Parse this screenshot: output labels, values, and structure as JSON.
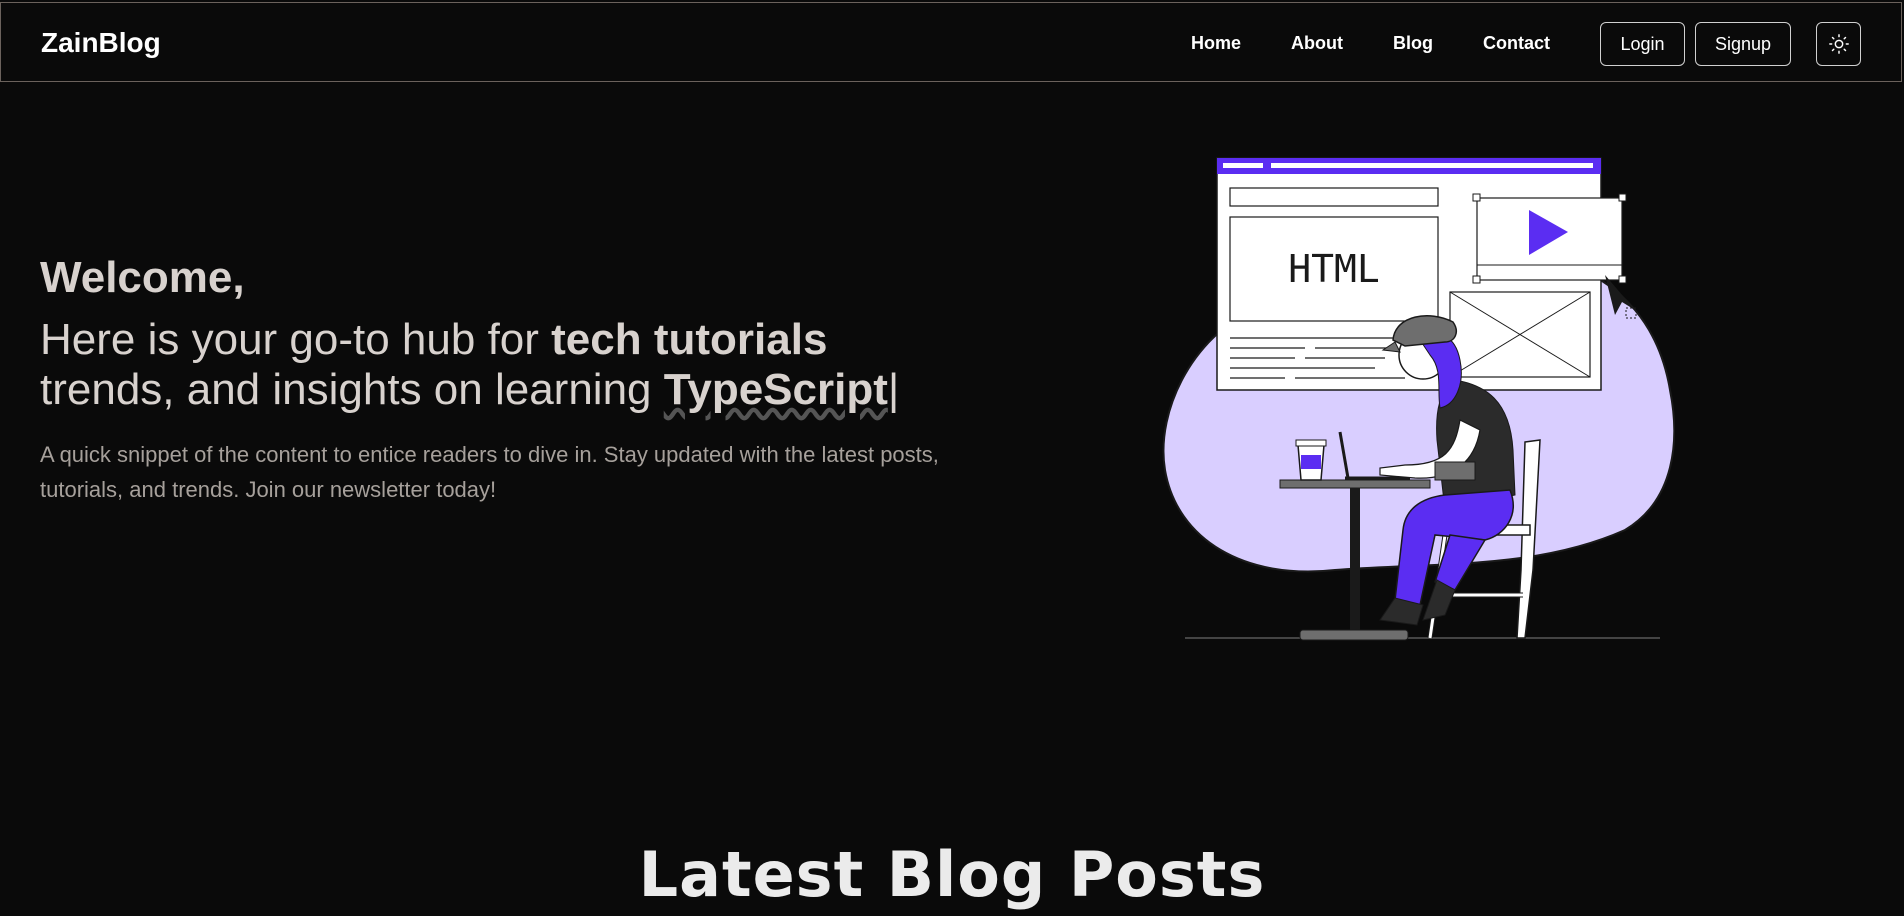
{
  "brand": {
    "name": "ZainBlog"
  },
  "nav": {
    "links": [
      "Home",
      "About",
      "Blog",
      "Contact"
    ],
    "login_label": "Login",
    "signup_label": "Signup",
    "theme_toggle_icon": "sun-icon"
  },
  "hero": {
    "welcome": "Welcome,",
    "tagline_part1": "Here is your go-to hub for ",
    "tagline_bold": "tech tutorials",
    "tagline_part2": "trends, and insights on learning ",
    "typed_word": "TypeScript",
    "caret": "|",
    "snippet": "A quick snippet of the content to entice readers to dive in. Stay updated with the latest posts, tutorials, and trends. Join our newsletter today!",
    "illustration_label": "HTML"
  },
  "latest": {
    "title": "Latest Blog Posts"
  },
  "colors": {
    "background": "#0a0a0a",
    "accent": "#5b2df2",
    "blob": "#d9ceff",
    "text_muted": "#a6a09b"
  }
}
